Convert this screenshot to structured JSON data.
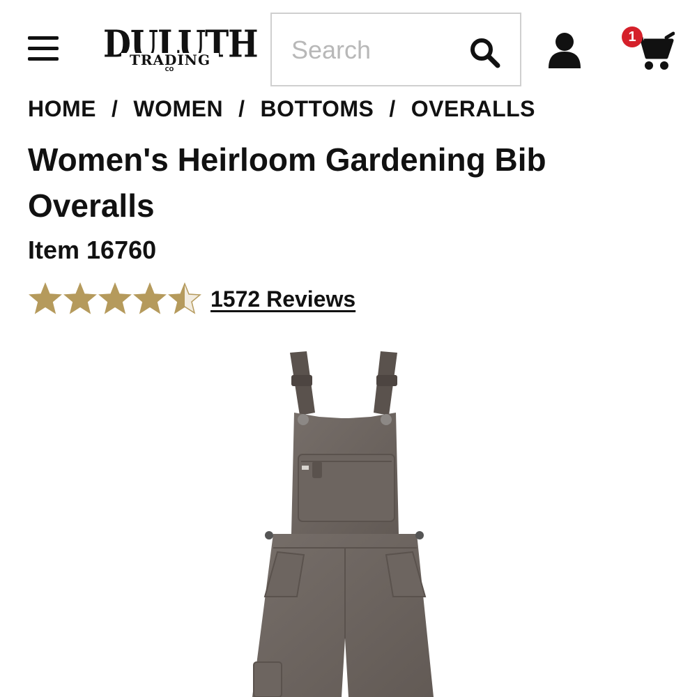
{
  "header": {
    "menu_icon": "hamburger-menu-icon",
    "logo": {
      "line1": "DULUTH",
      "line2": "TRADING",
      "line3": "CO"
    },
    "search": {
      "placeholder": "Search",
      "value": "",
      "icon": "search-icon"
    },
    "account_icon": "user-icon",
    "cart": {
      "icon": "cart-icon",
      "count": "1",
      "badge_color": "#d5202a"
    }
  },
  "breadcrumb": {
    "items": [
      "HOME",
      "WOMEN",
      "BOTTOMS",
      "OVERALLS"
    ],
    "separator": "/"
  },
  "product": {
    "title": "Women's Heirloom Gardening Bib Overalls",
    "item_number": "Item 16760",
    "rating": {
      "value": 4.5,
      "max": 5,
      "star_color": "#b59a5c"
    },
    "reviews_label": "1572 Reviews",
    "image": {
      "subject": "gray bib overalls",
      "color": "#6a625d"
    }
  }
}
